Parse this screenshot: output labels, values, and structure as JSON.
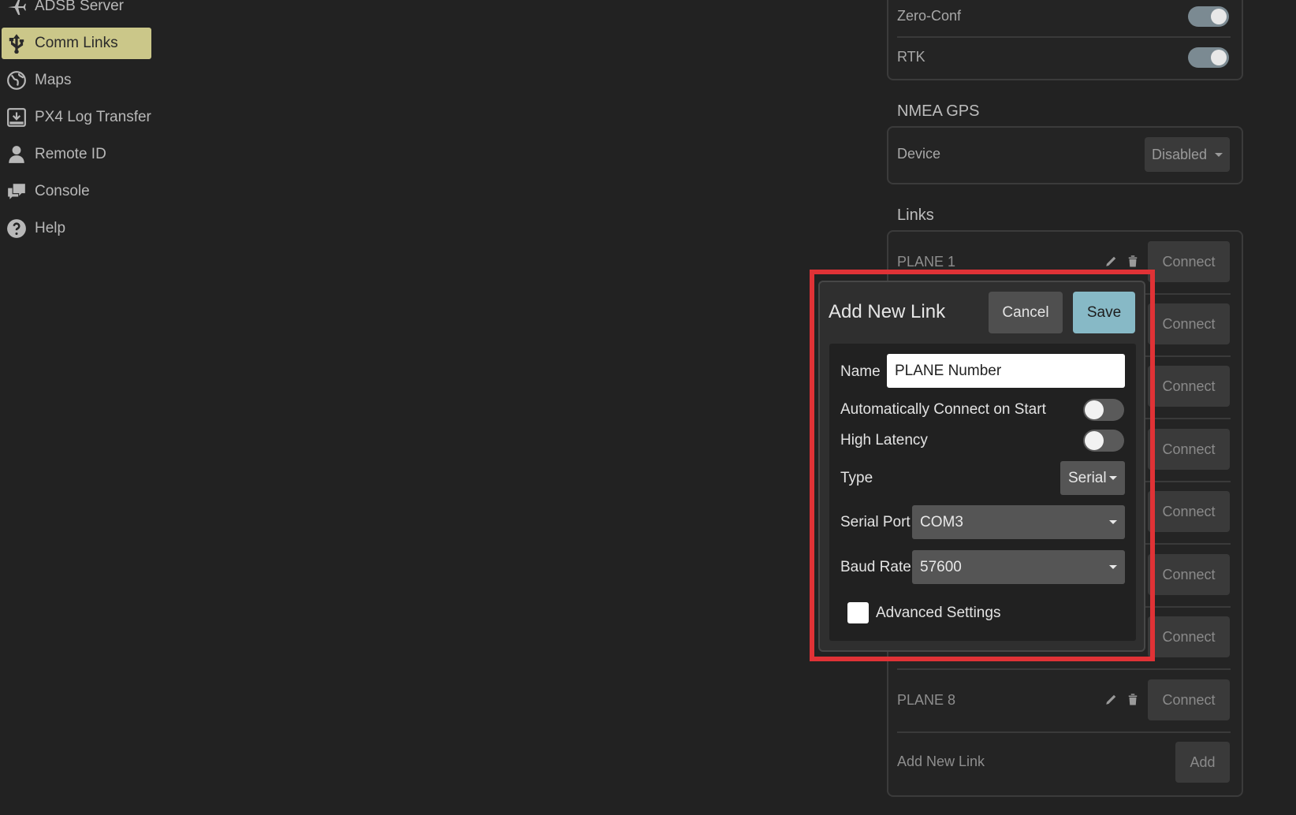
{
  "sidebar": {
    "items": [
      {
        "label": "ADSB Server",
        "icon": "plane-icon"
      },
      {
        "label": "Comm Links",
        "icon": "usb-icon",
        "active": true
      },
      {
        "label": "Maps",
        "icon": "globe-icon"
      },
      {
        "label": "PX4 Log Transfer",
        "icon": "download-icon"
      },
      {
        "label": "Remote ID",
        "icon": "person-icon"
      },
      {
        "label": "Console",
        "icon": "chat-icon"
      },
      {
        "label": "Help",
        "icon": "help-icon"
      }
    ]
  },
  "settings": {
    "zero_conf_label": "Zero-Conf",
    "zero_conf_on": true,
    "rtk_label": "RTK",
    "rtk_on": true,
    "nmea_title": "NMEA GPS",
    "device_label": "Device",
    "device_value": "Disabled",
    "links_title": "Links",
    "links": [
      {
        "name": "PLANE 1",
        "button": "Connect"
      },
      {
        "name": "",
        "button": "Connect"
      },
      {
        "name": "",
        "button": "Connect"
      },
      {
        "name": "",
        "button": "Connect"
      },
      {
        "name": "",
        "button": "Connect"
      },
      {
        "name": "",
        "button": "Connect"
      },
      {
        "name": "",
        "button": "Connect"
      },
      {
        "name": "PLANE 8",
        "button": "Connect"
      }
    ],
    "add_new_link_label": "Add New Link",
    "add_button": "Add"
  },
  "dialog": {
    "title": "Add New Link",
    "cancel_label": "Cancel",
    "save_label": "Save",
    "name_label": "Name",
    "name_value": "PLANE Number",
    "auto_connect_label": "Automatically Connect on Start",
    "auto_connect_on": false,
    "high_latency_label": "High Latency",
    "high_latency_on": false,
    "type_label": "Type",
    "type_value": "Serial",
    "serial_port_label": "Serial Port",
    "serial_port_value": "COM3",
    "baud_rate_label": "Baud Rate",
    "baud_rate_value": "57600",
    "advanced_label": "Advanced Settings",
    "advanced_checked": false
  },
  "colors": {
    "background": "#222222",
    "active_nav": "#cbc789",
    "save_button": "#87b9c6",
    "highlight_border": "#e03236"
  }
}
